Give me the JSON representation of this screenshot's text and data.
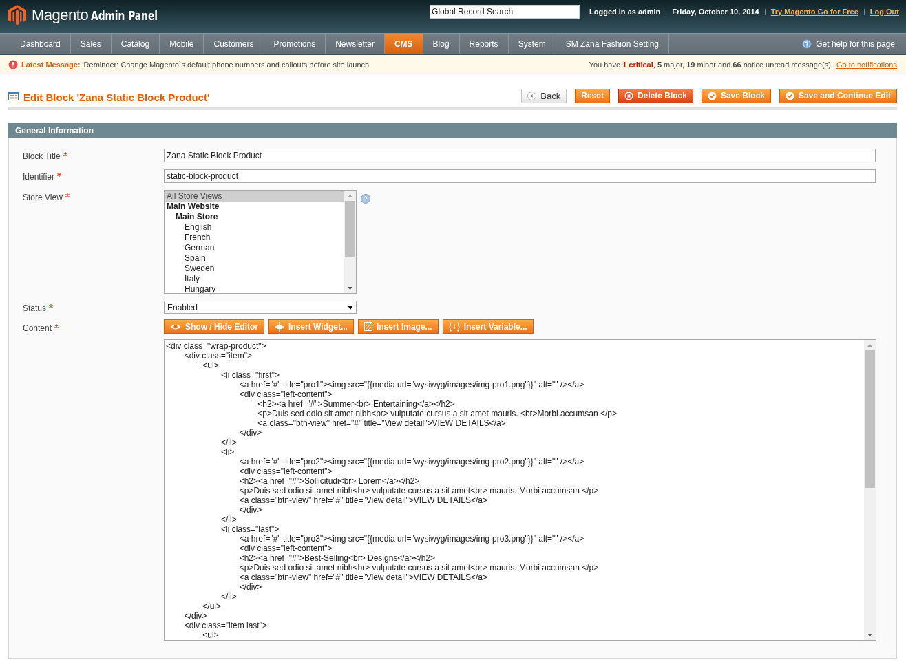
{
  "header": {
    "logo_word": "Magento",
    "logo_suffix": "Admin Panel",
    "search": {
      "placeholder": "Global Record Search"
    },
    "user": "Logged in as admin",
    "date": "Friday, October 10, 2014",
    "links": [
      "Try Magento Go for Free",
      "Log Out"
    ]
  },
  "nav": {
    "items": [
      {
        "label": "Dashboard",
        "selected": false
      },
      {
        "label": "Sales",
        "selected": false
      },
      {
        "label": "Catalog",
        "selected": false
      },
      {
        "label": "Mobile",
        "selected": false
      },
      {
        "label": "Customers",
        "selected": false
      },
      {
        "label": "Promotions",
        "selected": false
      },
      {
        "label": "Newsletter",
        "selected": false
      },
      {
        "label": "CMS",
        "selected": true
      },
      {
        "label": "Blog",
        "selected": false
      },
      {
        "label": "Reports",
        "selected": false
      },
      {
        "label": "System",
        "selected": false
      },
      {
        "label": "SM Zana Fashion Setting",
        "selected": false
      }
    ],
    "help": "Get help for this page"
  },
  "message": {
    "label": "Latest Message:",
    "text": "Reminder: Change Magento`s default phone numbers and callouts before site launch",
    "summary": [
      {
        "text": "You have ",
        "kind": "plain"
      },
      {
        "text": "1 critical",
        "kind": "critical"
      },
      {
        "text": ", ",
        "kind": "plain"
      },
      {
        "text": "5",
        "kind": "bold"
      },
      {
        "text": " major, ",
        "kind": "plain"
      },
      {
        "text": "19",
        "kind": "bold"
      },
      {
        "text": " minor and ",
        "kind": "plain"
      },
      {
        "text": "66",
        "kind": "bold"
      },
      {
        "text": " notice unread message(s). ",
        "kind": "plain"
      }
    ],
    "link": "Go to notifications"
  },
  "page": {
    "title": "Edit Block 'Zana Static Block Product'",
    "buttons": [
      {
        "label": "Back",
        "kind": "back"
      },
      {
        "label": "Reset",
        "kind": "plain"
      },
      {
        "label": "Delete Block",
        "kind": "delete"
      },
      {
        "label": "Save Block",
        "kind": "save"
      },
      {
        "label": "Save and Continue Edit",
        "kind": "save"
      }
    ]
  },
  "section": {
    "title": "General Information",
    "fields": [
      {
        "label": "Block Title",
        "required": true,
        "kind": "text",
        "value": "Zana Static Block Product"
      },
      {
        "label": "Identifier",
        "required": true,
        "kind": "text",
        "value": "static-block-product"
      },
      {
        "label": "Store View",
        "required": true,
        "kind": "multiselect",
        "options": [
          {
            "label": "All Store Views",
            "selected": true
          },
          {
            "label": "Main Website",
            "selected": false,
            "children": [
              {
                "label": "Main Store",
                "selected": false,
                "children": [
                  {
                    "label": "English",
                    "selected": false
                  },
                  {
                    "label": "French",
                    "selected": false
                  },
                  {
                    "label": "German",
                    "selected": false
                  },
                  {
                    "label": "Spain",
                    "selected": false
                  },
                  {
                    "label": "Sweden",
                    "selected": false
                  },
                  {
                    "label": "Italy",
                    "selected": false
                  },
                  {
                    "label": "Hungary",
                    "selected": false
                  }
                ]
              }
            ]
          }
        ]
      },
      {
        "label": "Status",
        "required": true,
        "kind": "select",
        "value": "Enabled"
      },
      {
        "label": "Content",
        "required": true,
        "kind": "editor",
        "buttons": [
          {
            "label": "Show / Hide Editor",
            "kind": "eye"
          },
          {
            "label": "Insert Widget...",
            "kind": "widget"
          },
          {
            "label": "Insert Image...",
            "kind": "image"
          },
          {
            "label": "Insert Variable...",
            "kind": "variable"
          }
        ],
        "value": "<div class=\"wrap-product\">\n\t<div class=\"item\">\n\t\t<ul>\n\t\t\t<li class=\"first\">\n\t\t\t\t<a href=\"#\" title=\"pro1\"><img src=\"{{media url=\"wysiwyg/images/img-pro1.png\"}}\" alt=\"\" /></a>\n\t\t\t\t<div class=\"left-content\">\n\t\t\t\t\t<h2><a href=\"#\">Summer<br> Entertaining</a></h2>\n\t\t\t\t\t<p>Duis sed odio sit amet nibh<br> vulputate cursus a sit amet mauris. <br>Morbi accumsan </p>\n\t\t\t\t\t<a class=\"btn-view\" href=\"#\" title=\"View detail\">VIEW DETAILS</a>\n\t\t\t\t</div>\n\t\t\t</li>\n\t\t\t<li>\n\t\t\t\t<a href=\"#\" title=\"pro2\"><img src=\"{{media url=\"wysiwyg/images/img-pro2.png\"}}\" alt=\"\" /></a>\n\t\t\t\t<div class=\"left-content\">\n\t\t\t\t<h2><a href=\"#\">Sollicitudi<br> Lorem</a></h2>\n\t\t\t\t<p>Duis sed odio sit amet nibh<br> vulputate cursus a sit amet<br> mauris. Morbi accumsan </p>\n\t\t\t\t<a class=\"btn-view\" href=\"#\" title=\"View detail\">VIEW DETAILS</a>\n\t\t\t\t</div>\n\t\t\t</li>\n\t\t\t<li class=\"last\">\n\t\t\t\t<a href=\"#\" title=\"pro3\"><img src=\"{{media url=\"wysiwyg/images/img-pro3.png\"}}\" alt=\"\" /></a>\n\t\t\t\t<div class=\"left-content\">\n\t\t\t\t<h2><a href=\"#\">Best-Selling<br> Designs</a></h2>\n\t\t\t\t<p>Duis sed odio sit amet nibh<br> vulputate cursus a sit amet<br> mauris. Morbi accumsan </p>\n\t\t\t\t<a class=\"btn-view\" href=\"#\" title=\"View detail\">VIEW DETAILS</a>\n\t\t\t\t</div>\n\t\t\t</li>\n\t\t</ul>\n\t</div>\n\t<div class=\"item last\">\n\t\t<ul>"
      }
    ]
  }
}
